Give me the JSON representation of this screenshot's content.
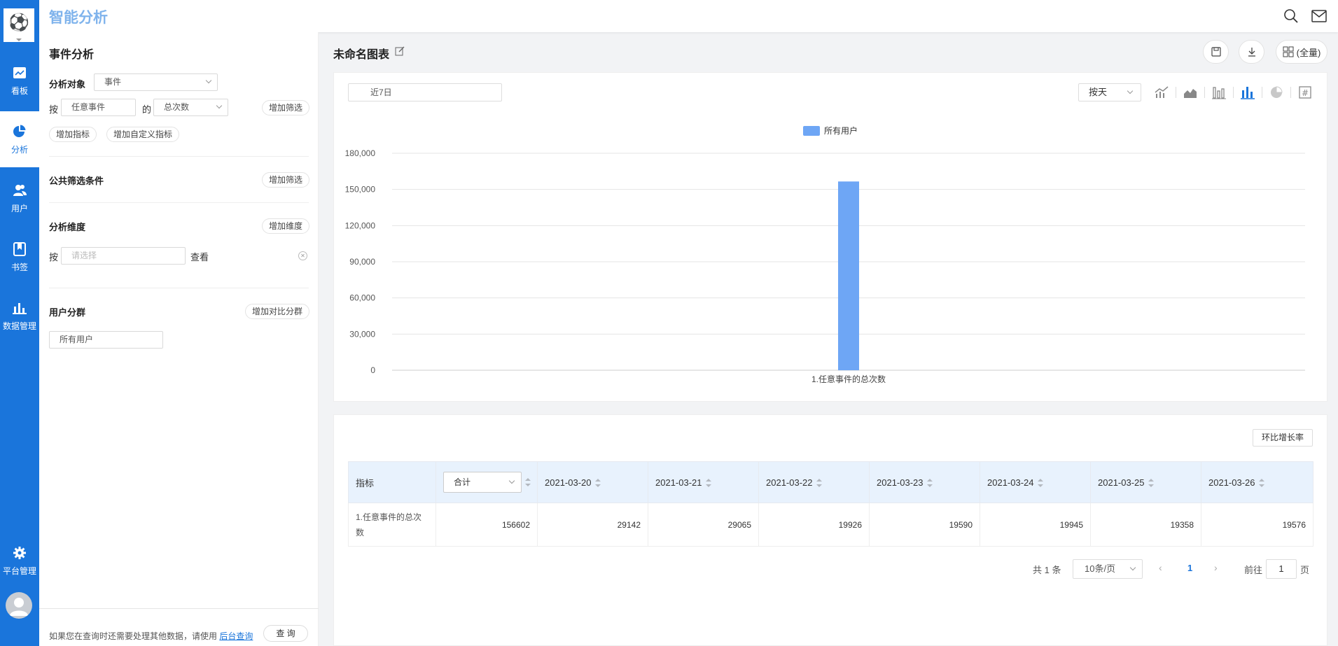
{
  "app": {
    "title": "智能分析"
  },
  "sidebar": {
    "items": [
      {
        "label": "看板",
        "icon": "dashboard-icon"
      },
      {
        "label": "分析",
        "icon": "pie-chart-icon",
        "active": true
      },
      {
        "label": "用户",
        "icon": "users-icon"
      },
      {
        "label": "书签",
        "icon": "bookmark-icon"
      },
      {
        "label": "数据管理",
        "icon": "bar-chart-icon"
      },
      {
        "label": "平台管理",
        "icon": "gear-icon"
      }
    ]
  },
  "left_panel": {
    "title": "事件分析",
    "analysis_object_label": "分析对象",
    "analysis_object_value": "事件",
    "by_label": "按",
    "event_value": "任意事件",
    "of_label": "的",
    "metric_value": "总次数",
    "add_filter": "增加筛选",
    "add_metric": "增加指标",
    "add_custom_metric": "增加自定义指标",
    "public_filter_label": "公共筛选条件",
    "public_add_filter": "增加筛选",
    "dimension_label": "分析维度",
    "add_dimension": "增加维度",
    "dim_by_label": "按",
    "dim_placeholder": "请选择",
    "dim_view_label": "查看",
    "segment_label": "用户分群",
    "add_compare_segment": "增加对比分群",
    "segment_value": "所有用户",
    "footer_text": "如果您在查询时还需要处理其他数据，请使用",
    "footer_link": "后台查询",
    "query_button": "查 询"
  },
  "main": {
    "chart_name": "未命名图表",
    "view_button": "(全量)",
    "date_range": "近7日",
    "granularity": "按天",
    "growth_button": "环比增长率",
    "colors": {
      "accent": "#1a75db",
      "bar": "#6ea6f5",
      "header_bg": "#e8f2fd"
    }
  },
  "chart_data": {
    "type": "bar",
    "categories": [
      "1.任意事件的总次数"
    ],
    "series": [
      {
        "name": "所有用户",
        "values": [
          156602
        ]
      }
    ],
    "ylim": [
      0,
      180000
    ],
    "yticks": [
      "0",
      "30,000",
      "60,000",
      "90,000",
      "120,000",
      "150,000",
      "180,000"
    ],
    "ytick_values": [
      0,
      30000,
      60000,
      90000,
      120000,
      150000,
      180000
    ],
    "legend": "top-center",
    "grid": true
  },
  "table": {
    "col_metric": "指标",
    "col_total_select": "合计",
    "dates": [
      "2021-03-20",
      "2021-03-21",
      "2021-03-22",
      "2021-03-23",
      "2021-03-24",
      "2021-03-25",
      "2021-03-26"
    ],
    "rows": [
      {
        "metric": "1.任意事件的总次数",
        "total": "156602",
        "values": [
          "29142",
          "29065",
          "19926",
          "19590",
          "19945",
          "19358",
          "19576"
        ]
      }
    ]
  },
  "pagination": {
    "total_text": "共 1 条",
    "page_size": "10条/页",
    "current_page": "1",
    "goto_label": "前往",
    "goto_value": "1",
    "page_suffix": "页"
  }
}
